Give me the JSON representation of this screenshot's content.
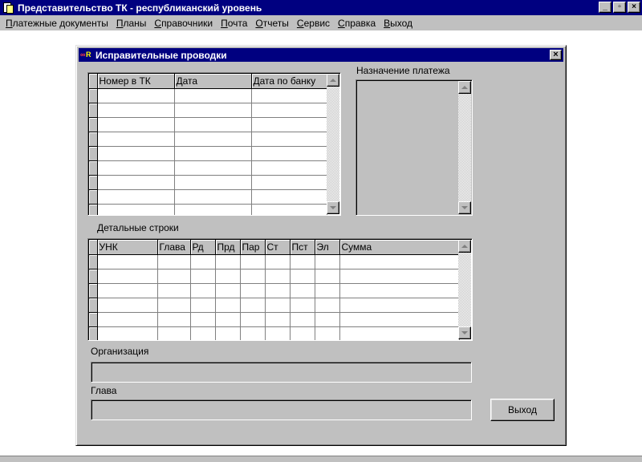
{
  "app": {
    "title": "Представительство ТК - республиканский уровень",
    "window_buttons": [
      "_",
      "▫",
      "×"
    ]
  },
  "menu": [
    {
      "label": "Платежные документы",
      "accel": "П",
      "rest": "латежные документы"
    },
    {
      "label": "Планы",
      "accel": "П",
      "rest": "ланы"
    },
    {
      "label": "Справочники",
      "accel": "С",
      "rest": "правочники"
    },
    {
      "label": "Почта",
      "accel": "П",
      "rest": "очта"
    },
    {
      "label": "Отчеты",
      "accel": "О",
      "rest": "тчеты"
    },
    {
      "label": "Сервис",
      "accel": "С",
      "rest": "ервис"
    },
    {
      "label": "Справка",
      "accel": "С",
      "rest": "правка"
    },
    {
      "label": "Выход",
      "accel": "В",
      "rest": "ыход"
    }
  ],
  "dialog": {
    "title": "Исправительные проводки",
    "close": "×",
    "top_grid": {
      "columns": [
        "Номер в ТК",
        "Дата",
        "Дата по банку"
      ],
      "row_count": 9
    },
    "memo_label": "Назначение платежа",
    "detail_label": "Детальные строки",
    "detail_grid": {
      "columns": [
        "УНК",
        "Глава",
        "Рд",
        "Прд",
        "Пар",
        "Ст",
        "Пст",
        "Эл",
        "Сумма"
      ],
      "row_count": 6
    },
    "org_label": "Организация",
    "org_value": "",
    "chapter_label": "Глава",
    "chapter_value": "",
    "exit_button": "Выход"
  }
}
